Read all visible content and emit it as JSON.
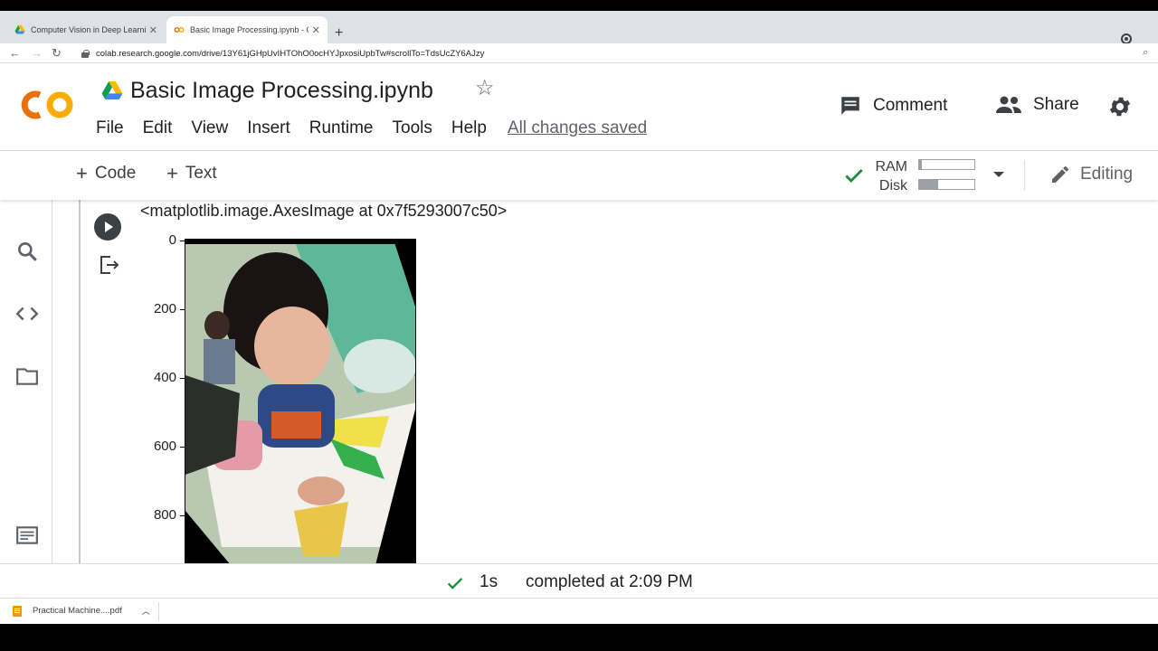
{
  "browser": {
    "tabs": [
      {
        "title": "Computer Vision in Deep Learnin",
        "icon": "google-drive-icon",
        "active": false
      },
      {
        "title": "Basic Image Processing.ipynb - C",
        "icon": "colab-icon",
        "active": true
      }
    ],
    "new_tab_label": "+",
    "url": "colab.research.google.com/drive/13Y61jGHpUvIHTOhO0ocHYJpxosiUpbTw#scrollTo=TdsUcZY6AJzy"
  },
  "colab": {
    "logo_text": "CO",
    "notebook_title": "Basic Image Processing.ipynb",
    "menu": [
      "File",
      "Edit",
      "View",
      "Insert",
      "Runtime",
      "Tools",
      "Help"
    ],
    "save_status": "All changes saved",
    "comment_label": "Comment",
    "share_label": "Share"
  },
  "toolbar": {
    "add_code_label": "Code",
    "add_text_label": "Text",
    "ram_label": "RAM",
    "disk_label": "Disk",
    "ram_usage": 0.05,
    "disk_usage": 0.35,
    "editing_label": "Editing"
  },
  "cell": {
    "output_text": "<matplotlib.image.AxesImage at 0x7f5293007c50>",
    "y_ticks": [
      "0",
      "200",
      "400",
      "600",
      "800"
    ]
  },
  "status": {
    "duration": "1s",
    "completed": "completed at 2:09 PM"
  },
  "downloads": {
    "file_name": "Practical Machine....pdf"
  },
  "colors": {
    "colab_orange": "#f9ab00",
    "colab_orange_dark": "#e8710a",
    "check_green": "#1e8e3e"
  }
}
